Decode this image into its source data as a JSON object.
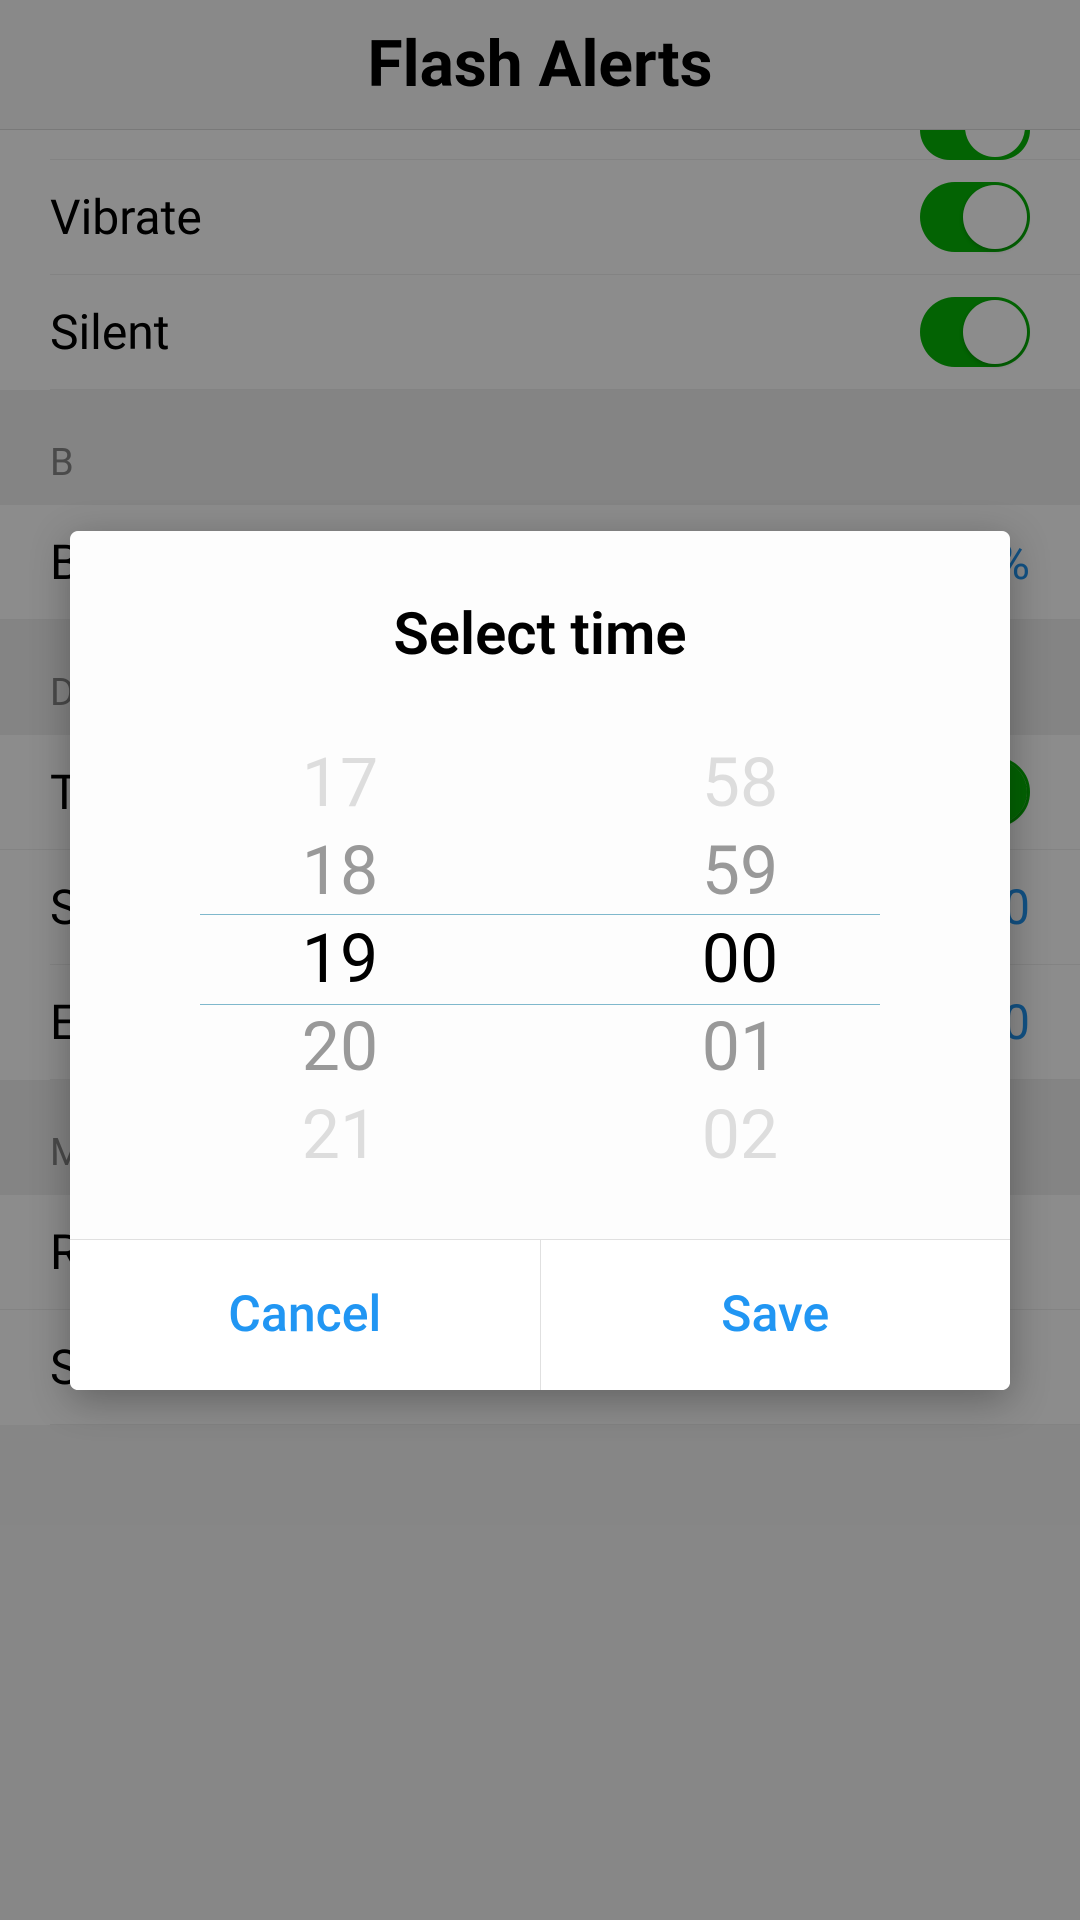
{
  "header": {
    "title": "Flash Alerts"
  },
  "settings": {
    "vibrate_label": "Vibrate",
    "silent_label": "Silent",
    "section_b": "B",
    "item_b": "B",
    "item_b_value": "%",
    "section_d": "D",
    "item_t": "T",
    "item_s": "S",
    "item_s_value": "0",
    "item_e": "E",
    "item_e_value": "0",
    "section_more": "MORE",
    "rate_label": "Rate this app",
    "share_label": "Share"
  },
  "dialog": {
    "title": "Select time",
    "hours": {
      "v0": "17",
      "v1": "18",
      "v2": "19",
      "v3": "20",
      "v4": "21"
    },
    "minutes": {
      "v0": "58",
      "v1": "59",
      "v2": "00",
      "v3": "01",
      "v4": "02"
    },
    "cancel_label": "Cancel",
    "save_label": "Save"
  }
}
